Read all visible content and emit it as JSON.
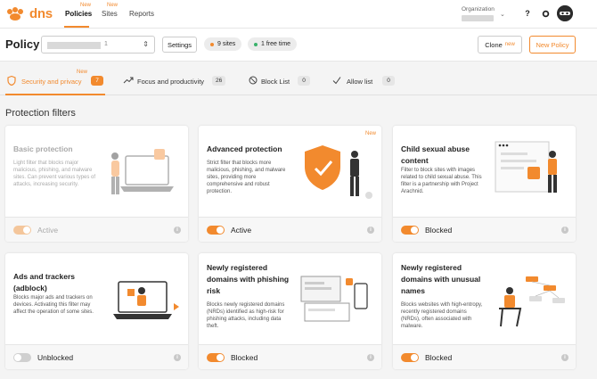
{
  "brand": {
    "name": "dns",
    "accent": "#f28a2e"
  },
  "nav": {
    "items": [
      {
        "label": "Policies",
        "new": "New",
        "active": true
      },
      {
        "label": "Sites",
        "new": "New",
        "active": false
      },
      {
        "label": "Reports",
        "new": "",
        "active": false
      }
    ]
  },
  "org": {
    "label": "Organization"
  },
  "header_icons": {
    "help": "?",
    "settings": "gear-icon"
  },
  "policybar": {
    "title": "Policy",
    "select_suffix": "1",
    "settings_label": "Settings",
    "sites_pill": "9 sites",
    "free_pill": "1 free time",
    "clone_label": "Clone",
    "clone_new": "new",
    "new_policy_label": "New Policy"
  },
  "tabs": [
    {
      "label": "Security and privacy",
      "count": "7",
      "new": "New",
      "active": true,
      "icon": "shield-icon"
    },
    {
      "label": "Focus and productivity",
      "count": "26",
      "new": "",
      "active": false,
      "icon": "trend-icon"
    },
    {
      "label": "Block List",
      "count": "0",
      "new": "",
      "active": false,
      "icon": "block-icon"
    },
    {
      "label": "Allow list",
      "count": "0",
      "new": "",
      "active": false,
      "icon": "check-icon"
    }
  ],
  "section_title": "Protection filters",
  "cards": [
    {
      "title": "Basic protection",
      "desc": "Light filter that blocks major malicious, phishing, and malware sites. Can prevent various types of attacks, increasing security.",
      "status": "Active",
      "on": true,
      "disabled": true,
      "new": ""
    },
    {
      "title": "Advanced protection",
      "desc": "Strict filter that blocks more malicious, phishing, and malware sites, providing more comprehensive and robust protection.",
      "status": "Active",
      "on": true,
      "disabled": false,
      "new": "New"
    },
    {
      "title": "Child sexual abuse content",
      "desc": "Filter to block sites with images related to child sexual abuse. This filter is a partnership with Project Arachnid.",
      "status": "Blocked",
      "on": true,
      "disabled": false,
      "new": ""
    },
    {
      "title": "Ads and trackers (adblock)",
      "desc": "Blocks major ads and trackers on devices. Activating this filter may affect the operation of some sites.",
      "status": "Unblocked",
      "on": false,
      "disabled": false,
      "new": ""
    },
    {
      "title": "Newly registered domains with phishing risk",
      "desc": "Blocks newly registered domains (NRDs) identified as high-risk for phishing attacks, including data theft.",
      "status": "Blocked",
      "on": true,
      "disabled": false,
      "new": ""
    },
    {
      "title": "Newly registered domains with unusual names",
      "desc": "Blocks websites with high-entropy, recently registered domains (NRDs), often associated with malware.",
      "status": "Blocked",
      "on": true,
      "disabled": false,
      "new": ""
    }
  ]
}
